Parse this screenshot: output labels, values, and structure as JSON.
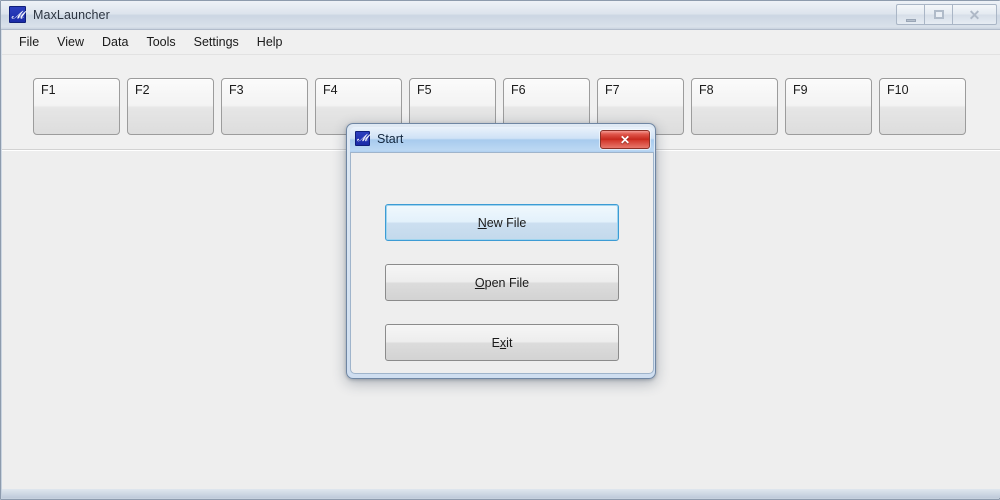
{
  "window": {
    "title": "MaxLauncher",
    "icon": "app-logo-icon",
    "controls": {
      "minimize_label": "",
      "maximize_label": "",
      "close_label": "✕"
    }
  },
  "menubar": {
    "items": [
      {
        "label": "File"
      },
      {
        "label": "View"
      },
      {
        "label": "Data"
      },
      {
        "label": "Tools"
      },
      {
        "label": "Settings"
      },
      {
        "label": "Help"
      }
    ]
  },
  "toolbar": {
    "fkeys": [
      {
        "label": "F1"
      },
      {
        "label": "F2"
      },
      {
        "label": "F3"
      },
      {
        "label": "F4"
      },
      {
        "label": "F5"
      },
      {
        "label": "F6"
      },
      {
        "label": "F7"
      },
      {
        "label": "F8"
      },
      {
        "label": "F9"
      },
      {
        "label": "F10"
      }
    ]
  },
  "dialog": {
    "title": "Start",
    "icon": "app-logo-icon",
    "close_label": "✕",
    "buttons": [
      {
        "accel": "N",
        "rest": "ew File",
        "state": "focused"
      },
      {
        "accel": "O",
        "rest": "pen File",
        "state": "normal"
      },
      {
        "pre": "E",
        "accel": "x",
        "rest": "it",
        "state": "normal"
      }
    ]
  },
  "colors": {
    "accent_blue": "#3c9bd4",
    "close_red": "#c6271c",
    "app_icon_blue": "#1b2ba8",
    "client_bg": "#eeeeee",
    "toolbar_bg": "#f0f0f0"
  }
}
